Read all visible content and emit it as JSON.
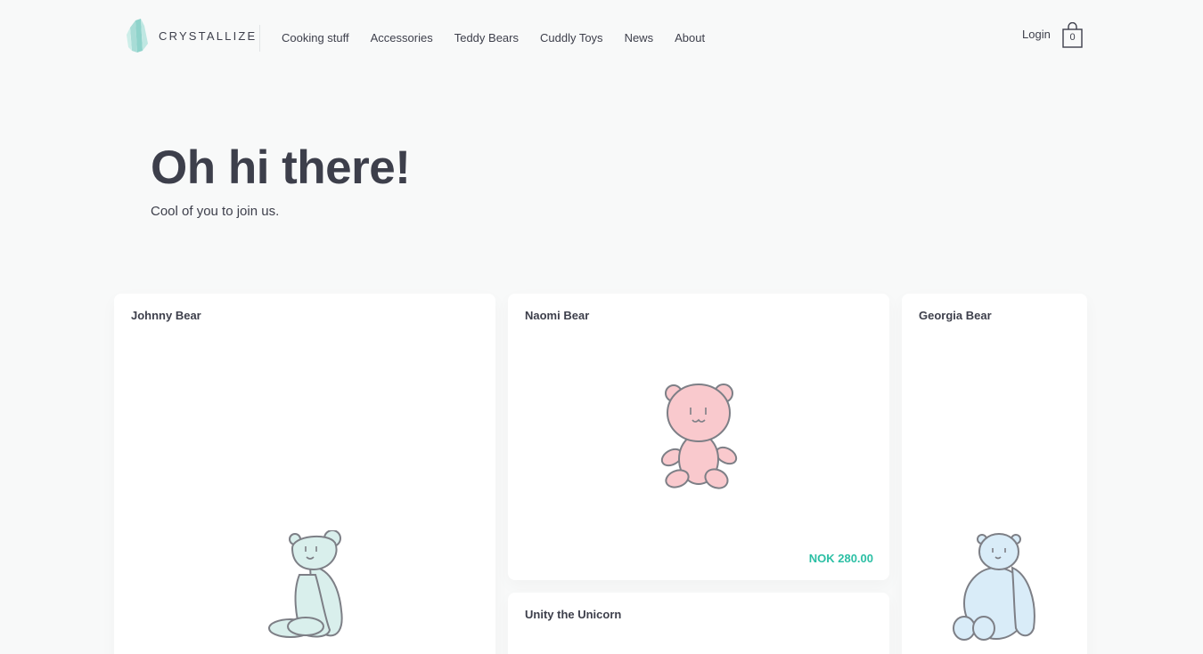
{
  "header": {
    "logo_text": "CRYSTALLIZE",
    "nav": [
      "Cooking stuff",
      "Accessories",
      "Teddy Bears",
      "Cuddly Toys",
      "News",
      "About"
    ],
    "login_label": "Login",
    "cart_count": "0"
  },
  "hero": {
    "title": "Oh hi there!",
    "subtitle": "Cool of you to join us."
  },
  "products": [
    {
      "name": "Johnny Bear",
      "price": "",
      "color": "#d9efec"
    },
    {
      "name": "Naomi Bear",
      "price": "NOK 280.00",
      "color": "#f9c9cd"
    },
    {
      "name": "Georgia Bear",
      "price": "",
      "color": "#d9ecf8"
    },
    {
      "name": "Unity the Unicorn",
      "price": "",
      "color": ""
    }
  ],
  "colors": {
    "accent": "#2bbfa4",
    "text": "#3d3f4b",
    "background": "#f8f9f9",
    "bear_outline": "#7d7f86"
  }
}
